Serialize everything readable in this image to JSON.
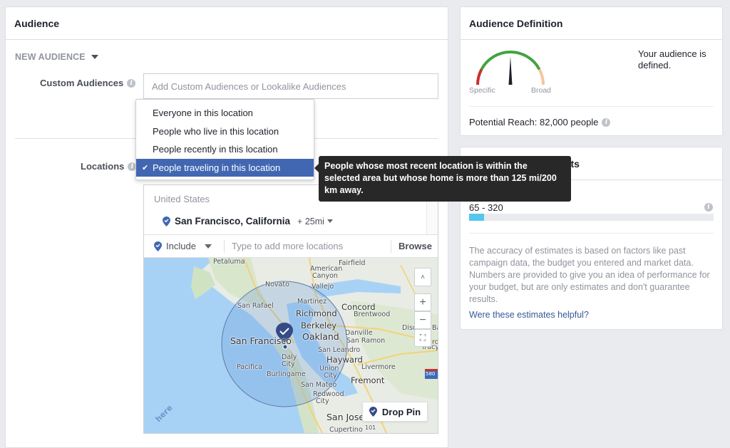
{
  "audience_panel": {
    "title": "Audience",
    "new_audience_label": "NEW AUDIENCE",
    "custom_audiences": {
      "label": "Custom Audiences",
      "placeholder": "Add Custom Audiences or Lookalike Audiences"
    },
    "locations": {
      "label": "Locations",
      "dropdown_options": [
        {
          "label": "Everyone in this location",
          "selected": false
        },
        {
          "label": "People who live in this location",
          "selected": false
        },
        {
          "label": "People recently in this location",
          "selected": false
        },
        {
          "label": "People traveling in this location",
          "selected": true
        }
      ],
      "selected_check": "✔",
      "tooltip": "People whose most recent location is within the selected area but whose home is more than 125 mi/200 km away.",
      "country": "United States",
      "location_item": {
        "city": "San Francisco, California",
        "radius": "+ 25mi"
      },
      "include_label": "Include",
      "search_placeholder": "Type to add more locations",
      "browse_label": "Browse"
    },
    "map": {
      "labels": [
        "Petaluma",
        "Fairfield",
        "American",
        "Canyon",
        "Novato",
        "Vallejo",
        "San Rafael",
        "Martinez",
        "Concord",
        "Richmond",
        "Brentwood",
        "Berkeley",
        "Oakland",
        "Danville",
        "San Ramon",
        "San Francisco",
        "San Leandro",
        "Hayward",
        "Daly",
        "City",
        "Pacifica",
        "Burlingame",
        "Union",
        "City",
        "Livermore",
        "San Mateo",
        "Fremont",
        "Redwood",
        "City",
        "San Jose",
        "Tracy",
        "Disc",
        "Bay",
        "rop",
        "Cupertino",
        "101",
        "580"
      ],
      "controls": {
        "collapse": "˄",
        "zoom_in": "+",
        "zoom_out": "−",
        "recenter": "⛶"
      },
      "drop_pin_label": "Drop Pin",
      "attribution": "here"
    }
  },
  "definition_panel": {
    "title": "Audience Definition",
    "gauge": {
      "low_label": "Specific",
      "high_label": "Broad",
      "level": 0.5,
      "colors": {
        "low": "#c9302c",
        "mid": "#42a33f",
        "high": "#f7c59f",
        "needle": "#1d2129"
      }
    },
    "status": "Your audience is defined.",
    "potential_reach": "Potential Reach: 82,000 people"
  },
  "results_panel": {
    "title_visible": "ults",
    "range": "65 - 320",
    "bar_fill_fraction": 0.06,
    "bar_color": "#54c7ec",
    "disclaimer": "The accuracy of estimates is based on factors like past campaign data, the budget you entered and market data. Numbers are provided to give you an idea of performance for your budget, but are only estimates and don't guarantee results.",
    "feedback_link": "Were these estimates helpful?"
  },
  "colors": {
    "accent": "#4267b2",
    "link": "#365899",
    "tooltip_bg": "#282828"
  }
}
